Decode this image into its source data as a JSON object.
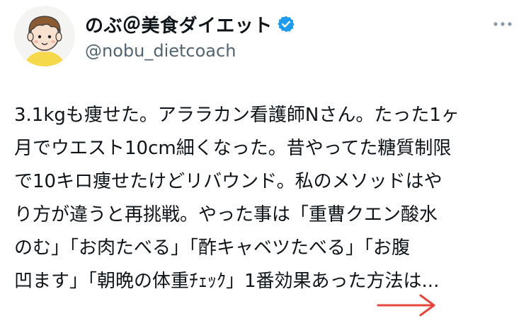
{
  "author": {
    "display_name": "のぶ＠美食ダイエット",
    "handle": "@nobu_dietcoach",
    "verified": true,
    "verified_color": "#1d9bf0"
  },
  "menu": {
    "more_icon": "more-horizontal-icon"
  },
  "tweet": {
    "lines": [
      "3.1kgも痩せた。アララカン看護師Nさん。たった1ヶ",
      "月でウエスト10cm細くなった。昔やってた糖質制限",
      "で10キロ痩せたけどリバウンド。私のメソッドはや",
      "り方が違うと再挑戦。やった事は「重曹クエン酸水",
      "のむ」「お肉たべる」「酢キャベツたべる」「お腹",
      "凹ます」「朝晩の体重ﾁｪｯｸ」1番効果あった方法は..."
    ]
  },
  "annotation": {
    "arrow_color": "#e8453c",
    "arrow_icon": "right-arrow-icon"
  }
}
